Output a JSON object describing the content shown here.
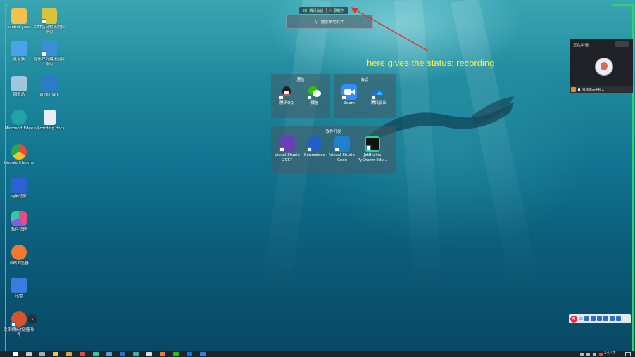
{
  "desktop": {
    "icons": [
      {
        "label": "sanhui yuan",
        "icon": "user-folder-icon",
        "color": "#f2c14e"
      },
      {
        "label": "CZT晶马模板射探测仪",
        "icon": "app-shortcut-icon",
        "color": "#d8c43a"
      },
      {
        "label": "此电脑",
        "icon": "computer-icon",
        "color": "#4aa3e8"
      },
      {
        "label": "晶体阵列模板射探测仪",
        "icon": "app-shortcut-icon",
        "color": "#3b8fd9"
      },
      {
        "label": "回收站",
        "icon": "recycle-bin-icon",
        "color": "#9fc7e0"
      },
      {
        "label": "Wireshark",
        "icon": "wireshark-icon",
        "color": "#2b7bc9"
      },
      {
        "label": "Microsoft Edge",
        "icon": "edge-icon",
        "color": "#1fa3a8"
      },
      {
        "label": "~$cording.docx",
        "icon": "word-document-icon",
        "color": "#e8eef5"
      },
      {
        "label": "Google Chrome",
        "icon": "chrome-icon",
        "color": "#e44b3a"
      },
      {
        "label": "电脑管家",
        "icon": "pc-manager-icon",
        "color": "#2a62d4"
      },
      {
        "label": "软件管理",
        "icon": "software-manager-icon",
        "color": "#e94a8a"
      },
      {
        "label": "双核浏览器",
        "icon": "browser-icon",
        "color": "#f07a2e"
      },
      {
        "label": "迅雷",
        "icon": "thunder-icon",
        "color": "#3a7de0"
      },
      {
        "label": "采集模板射测量软件",
        "icon": "app-shortcut-icon",
        "color": "#d7542c"
      }
    ]
  },
  "meeting_bar": {
    "app_name": "腾讯会议",
    "status": "录制中"
  },
  "search": {
    "placeholder": "搜索本地文件"
  },
  "annotation": {
    "text": "here gives the status: recording",
    "color": "#f7f34d"
  },
  "groups": {
    "comm": {
      "title": "通信",
      "items": [
        {
          "label": "腾讯QQ",
          "icon": "qq-icon",
          "color": "#1e1e1e"
        },
        {
          "label": "微信",
          "icon": "wechat-icon",
          "color": "#2dc100"
        }
      ]
    },
    "meeting": {
      "title": "会议",
      "items": [
        {
          "label": "Zoom",
          "icon": "zoom-icon",
          "color": "#2d8cff"
        },
        {
          "label": "腾讯会议",
          "icon": "tencent-meeting-icon",
          "color": "#1a6fe6"
        }
      ]
    },
    "dev": {
      "title": "软件开发",
      "items": [
        {
          "label": "Visual Studio 2017",
          "icon": "visual-studio-icon",
          "color": "#6a3fb5"
        },
        {
          "label": "Sourcetree",
          "icon": "sourcetree-icon",
          "color": "#1f5fc8"
        },
        {
          "label": "Visual Studio Code",
          "icon": "vscode-icon",
          "color": "#1f7fd0"
        },
        {
          "label": "JetBrains PyCharm Edu...",
          "icon": "pycharm-icon",
          "color": "#21d789"
        }
      ]
    }
  },
  "speaker_panel": {
    "title": "正在讲话:",
    "name": "张建辉@中科大"
  },
  "taskbar": {
    "time": "14:47",
    "accent": "#3b7fd0"
  }
}
